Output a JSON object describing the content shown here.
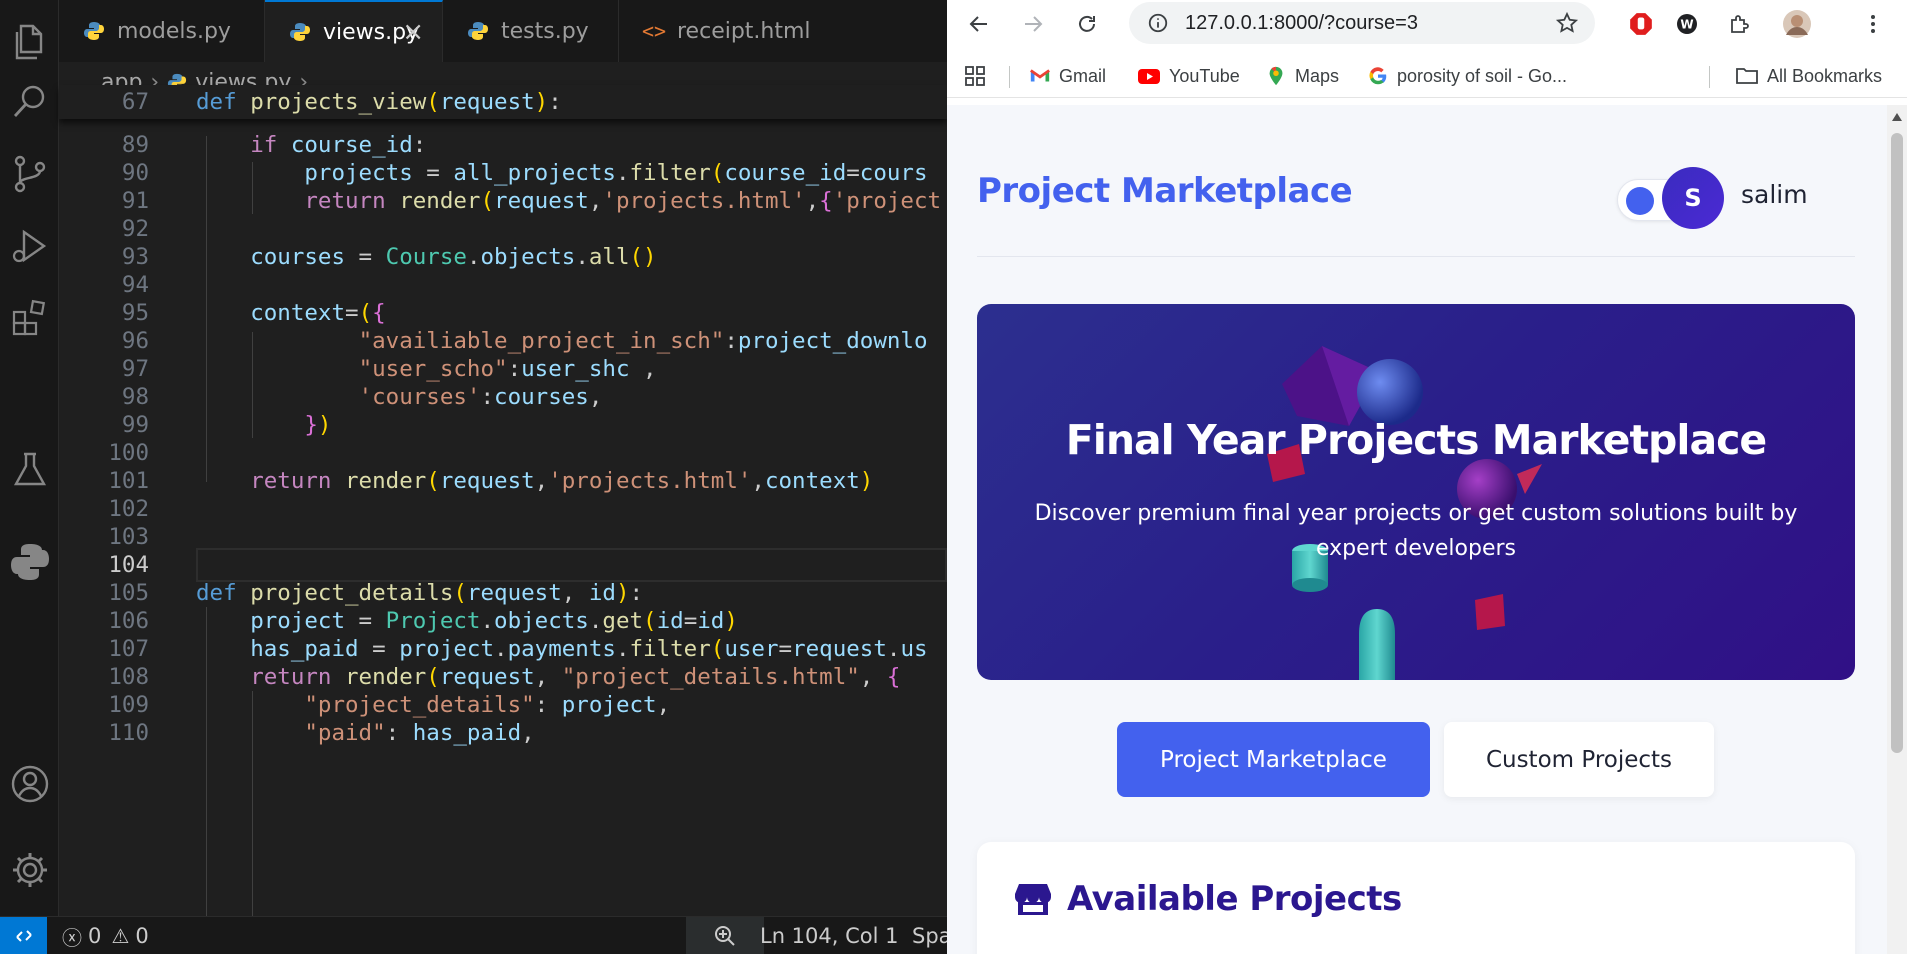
{
  "vscode": {
    "tabs": [
      {
        "label": "models.py",
        "active": false
      },
      {
        "label": "views.py",
        "active": true
      },
      {
        "label": "tests.py",
        "active": false
      },
      {
        "label": "receipt.html",
        "active": false
      }
    ],
    "breadcrumb": {
      "folder": "app",
      "file": "views.py",
      "more": "..."
    },
    "status": {
      "errors": "0",
      "warnings": "0",
      "cursor": "Ln 104, Col 1",
      "spaces": "Spa"
    }
  },
  "browser": {
    "url": "127.0.0.1:8000/?course=3",
    "bookmarks": [
      "Gmail",
      "YouTube",
      "Maps",
      "porosity of soil - Go...",
      "All Bookmarks"
    ]
  },
  "site": {
    "title": "Project Marketplace",
    "avatar_letter": "S",
    "username": "salim",
    "hero_title": "Final Year Projects Marketplace",
    "hero_subtitle": "Discover premium final year projects or get custom solutions built by expert developers",
    "tab_marketplace": "Project Marketplace",
    "tab_custom": "Custom Projects",
    "available_title": "Available Projects"
  },
  "colors": {
    "accent": "#4361ee",
    "hero_dark": "#301086",
    "vscode_blue": "#0078d4"
  }
}
